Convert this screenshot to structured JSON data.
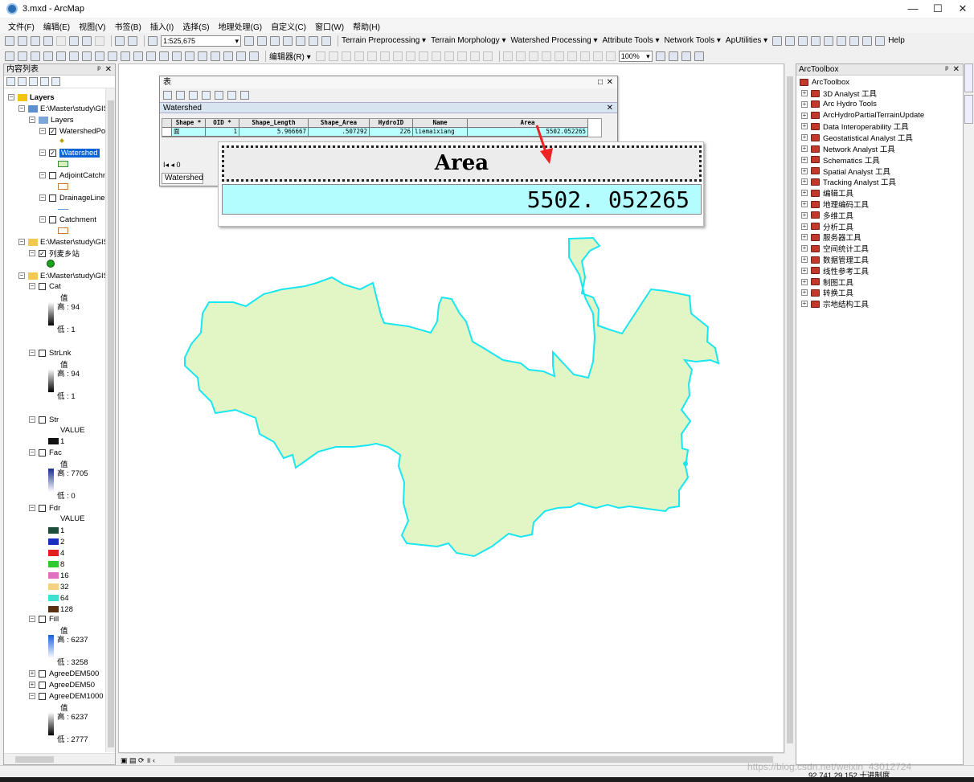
{
  "window": {
    "title": "3.mxd - ArcMap",
    "minimize": "—",
    "maximize": "☐",
    "close": "✕"
  },
  "menu": [
    "文件(F)",
    "编辑(E)",
    "视图(V)",
    "书签(B)",
    "插入(I)",
    "选择(S)",
    "地理处理(G)",
    "自定义(C)",
    "窗口(W)",
    "帮助(H)"
  ],
  "toolbar1": {
    "scale": "1:525,675",
    "menus": [
      "Terrain Preprocessing ▾",
      "Terrain Morphology ▾",
      "Watershed Processing ▾",
      "Attribute Tools ▾",
      "Network Tools ▾",
      "ApUtilities ▾"
    ],
    "help": "Help"
  },
  "toolbar2": {
    "editor": "编辑器(R) ▾",
    "zoom_pct": "100%"
  },
  "toc": {
    "title": "内容列表",
    "pin": "ᵖ",
    "close": "✕",
    "layers_root": "Layers",
    "group1": "E:\\Master\\study\\GIS",
    "group1_sub": "Layers",
    "items": {
      "watershedpo": "WatershedPo",
      "watershed": "Watershed",
      "adjoint": "AdjointCatchn",
      "drainage": "DrainageLine",
      "catchment": "Catchment",
      "group2": "E:\\Master\\study\\GIS",
      "station": "列麦乡站",
      "group3": "E:\\Master\\study\\GIS",
      "cat": "Cat",
      "cat_val": "值",
      "cat_hi": "高 : 94",
      "cat_lo": "低 : 1",
      "strlnk": "StrLnk",
      "strlnk_val": "值",
      "strlnk_hi": "高 : 94",
      "strlnk_lo": "低 : 1",
      "str": "Str",
      "str_value": "VALUE",
      "str_1": "1",
      "fac": "Fac",
      "fac_val": "值",
      "fac_hi": "高 : 7705",
      "fac_lo": "低 : 0",
      "fdr": "Fdr",
      "fdr_value": "VALUE",
      "fdr_classes": [
        "1",
        "2",
        "4",
        "8",
        "16",
        "32",
        "64",
        "128"
      ],
      "fill": "Fill",
      "fill_val": "值",
      "fill_hi": "高 : 6237",
      "fill_lo": "低 : 3258",
      "agree500": "AgreeDEM500",
      "agree50": "AgreeDEM50",
      "agree1000": "AgreeDEM1000",
      "agree1000_val": "值",
      "agree1000_hi": "高 : 6237",
      "agree1000_lo": "低 : 2777"
    },
    "fdr_colors": [
      "#1d4e3c",
      "#1a2fbf",
      "#e02020",
      "#30c830",
      "#e070c0",
      "#f5d080",
      "#40e0d0",
      "#5a3010"
    ]
  },
  "table": {
    "window_title": "表",
    "layer_tab": "Watershed",
    "bottom_tab": "Watershed",
    "nav": "I◂  ◂        0",
    "columns": [
      "Shape *",
      "OID *",
      "Shape_Length",
      "Shape_Area",
      "HydroID",
      "Name",
      "Area"
    ],
    "row": [
      "面",
      "1",
      "5.966667",
      ".507292",
      "226",
      "liemaixiang",
      "5502.052265"
    ]
  },
  "callout": {
    "header": "Area",
    "value": "5502. 052265"
  },
  "arctoolbox": {
    "title": "ArcToolbox",
    "root": "ArcToolbox",
    "items": [
      "3D Analyst 工具",
      "Arc Hydro Tools",
      "ArcHydroPartialTerrainUpdate",
      "Data Interoperability 工具",
      "Geostatistical Analyst 工具",
      "Network Analyst 工具",
      "Schematics 工具",
      "Spatial Analyst 工具",
      "Tracking Analyst 工具",
      "编辑工具",
      "地理编码工具",
      "多维工具",
      "分析工具",
      "服务器工具",
      "空间统计工具",
      "数据管理工具",
      "线性参考工具",
      "制图工具",
      "转换工具",
      "宗地结构工具"
    ]
  },
  "status": {
    "coords": "92.741  29.152 十进制度",
    "watermark": "https://blog.csdn.net/weixin_43012724"
  },
  "colors": {
    "watershed_fill": "#e2f5c4",
    "watershed_outline": "#19e6f2",
    "selection_row": "#b9ffff",
    "arrow": "#ee2222"
  }
}
